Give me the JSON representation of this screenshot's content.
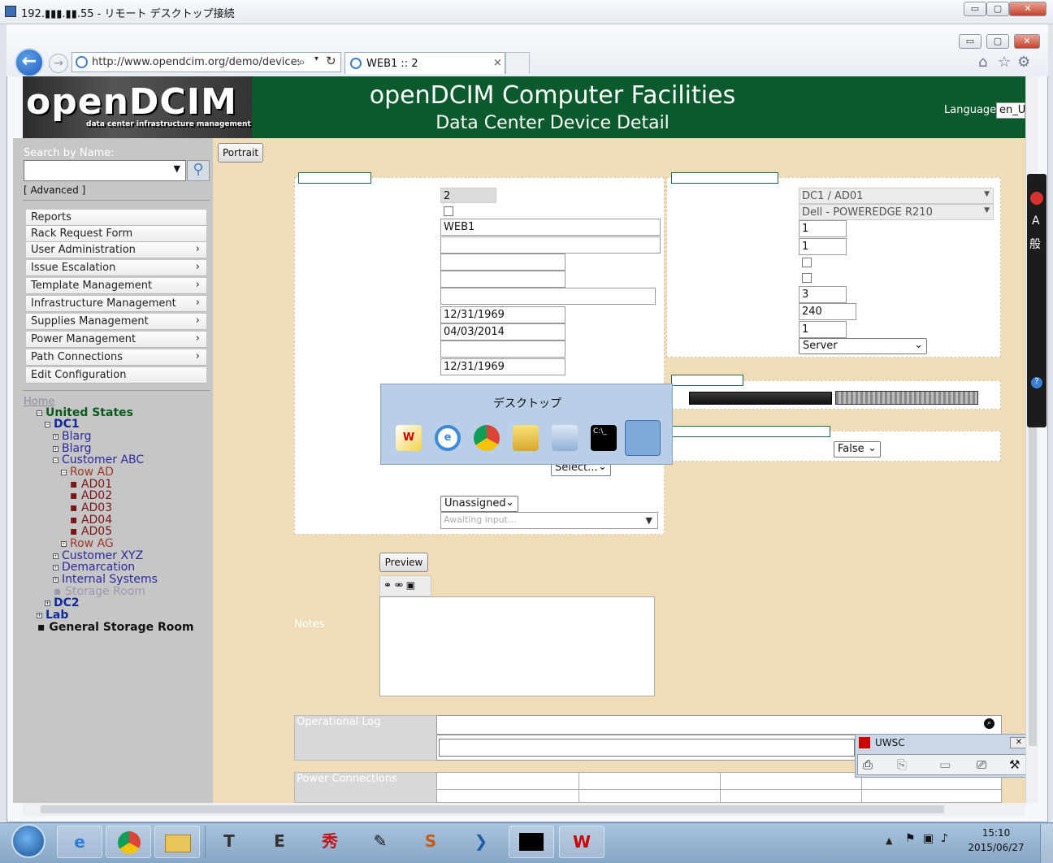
{
  "rdp": {
    "title": "192.▮▮▮.▮▮.55 - リモート デスクトップ接続",
    "min": "▭",
    "max": "▢",
    "close": "✕"
  },
  "browser": {
    "url": "http://www.opendcim.org/demo/devices.pl",
    "tab_title": "WEB1 :: 2",
    "tab_close": "×",
    "back_glyph": "←",
    "fwd_glyph": "→",
    "search_glyph": "⌕",
    "refresh_glyph": "↻",
    "home_glyph": "⌂",
    "fav_glyph": "☆",
    "gear_glyph": "⚙"
  },
  "header": {
    "logo": "openDCIM",
    "logo_sub": "data center infrastructure management",
    "title": "openDCIM Computer Facilities",
    "subtitle": "Data Center Device Detail",
    "language_label": "Language",
    "language_value": "en_U"
  },
  "sidebar": {
    "search_label": "Search by Name:",
    "advanced": "[ Advanced ]",
    "menu": [
      {
        "label": "Reports",
        "arrow": ""
      },
      {
        "label": "Rack Request Form",
        "arrow": ""
      },
      {
        "label": "User Administration",
        "arrow": "›"
      },
      {
        "label": "Issue Escalation",
        "arrow": "›"
      },
      {
        "label": "Template Management",
        "arrow": "›"
      },
      {
        "label": "Infrastructure Management",
        "arrow": "›"
      },
      {
        "label": "Supplies Management",
        "arrow": "›"
      },
      {
        "label": "Power Management",
        "arrow": "›"
      },
      {
        "label": "Path Connections",
        "arrow": "›"
      },
      {
        "label": "Edit Configuration",
        "arrow": ""
      }
    ],
    "tree": {
      "home": "Home",
      "united_states": "United States",
      "dc1": "DC1",
      "blarg1": "Blarg",
      "blarg2": "Blarg",
      "customer_abc": "Customer ABC",
      "row_ad": "Row AD",
      "ad01": "AD01",
      "ad02": "AD02",
      "ad03": "AD03",
      "ad04": "AD04",
      "ad05": "AD05",
      "row_ag": "Row AG",
      "customer_xyz": "Customer XYZ",
      "demarcation": "Demarcation",
      "internal_systems": "Internal Systems",
      "storage_room": "Storage Room",
      "dc2": "DC2",
      "lab": "Lab",
      "general_storage": "General Storage Room"
    }
  },
  "form": {
    "portrait_button": "Portrait",
    "device_id": "2",
    "label": "WEB1",
    "install_date": "12/31/1969",
    "warranty_date": "04/03/2014",
    "last_date": "12/31/1969",
    "select_placeholder": "Select...",
    "assign_select": "Unassigned",
    "awaiting": "Awaiting input...",
    "cabinet": "DC1 / AD01",
    "model": "Dell  -  POWEREDGE R210",
    "height": "1",
    "position": "1",
    "ports": "3",
    "nominal_watts": "240",
    "power_supplies": "1",
    "device_type": "Server",
    "false_select": "False",
    "preview_button": "Preview",
    "notes_label": "Notes",
    "oplog_label": "Operational Log",
    "power_label": "Power Connections"
  },
  "flyout": {
    "title": "デスクトップ"
  },
  "uwsc": {
    "title": "UWSC",
    "close": "✕"
  },
  "taskbar": {
    "time": "15:10",
    "date": "2015/06/27"
  }
}
